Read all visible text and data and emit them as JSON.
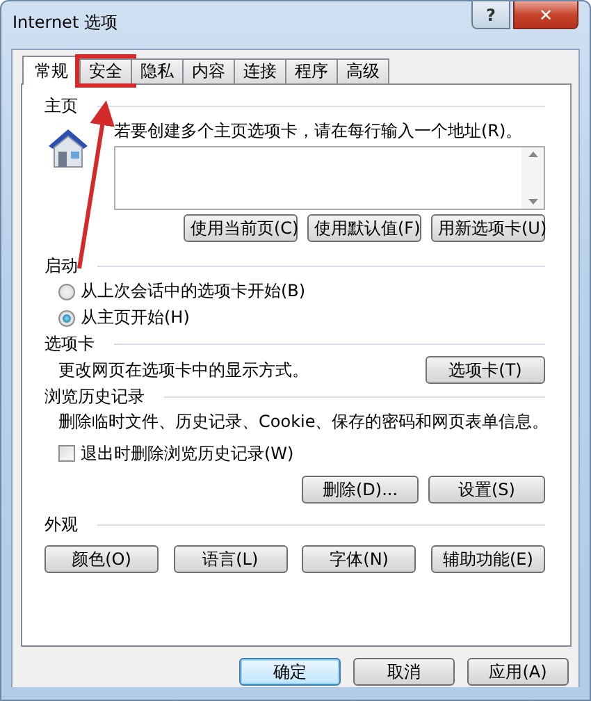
{
  "window": {
    "title": "Internet 选项",
    "help": "?",
    "close": "✕"
  },
  "tabs": [
    {
      "label": "常规",
      "selected": true,
      "highlighted": false
    },
    {
      "label": "安全",
      "selected": false,
      "highlighted": true
    },
    {
      "label": "隐私",
      "selected": false,
      "highlighted": false
    },
    {
      "label": "内容",
      "selected": false,
      "highlighted": false
    },
    {
      "label": "连接",
      "selected": false,
      "highlighted": false
    },
    {
      "label": "程序",
      "selected": false,
      "highlighted": false
    },
    {
      "label": "高级",
      "selected": false,
      "highlighted": false
    }
  ],
  "home_page": {
    "heading": "主页",
    "hint": "若要创建多个主页选项卡，请在每行输入一个地址(R)。",
    "buttons": [
      "使用当前页(C)",
      "使用默认值(F)",
      "用新选项卡(U)"
    ]
  },
  "startup": {
    "heading": "启动",
    "options": [
      {
        "label": "从上次会话中的选项卡开始(B)",
        "selected": false
      },
      {
        "label": "从主页开始(H)",
        "selected": true
      }
    ]
  },
  "tabs_section": {
    "heading": "选项卡",
    "text": "更改网页在选项卡中的显示方式。",
    "button": "选项卡(T)"
  },
  "history": {
    "heading": "浏览历史记录",
    "text": "删除临时文件、历史记录、Cookie、保存的密码和网页表单信息。",
    "checkbox": {
      "label": "退出时删除浏览历史记录(W)",
      "checked": false
    },
    "buttons": [
      "删除(D)...",
      "设置(S)"
    ]
  },
  "appearance": {
    "heading": "外观",
    "buttons": [
      "颜色(O)",
      "语言(L)",
      "字体(N)",
      "辅助功能(E)"
    ]
  },
  "footer_buttons": [
    {
      "label": "确定",
      "default": true
    },
    {
      "label": "取消",
      "default": false
    },
    {
      "label": "应用(A)",
      "default": false
    }
  ]
}
